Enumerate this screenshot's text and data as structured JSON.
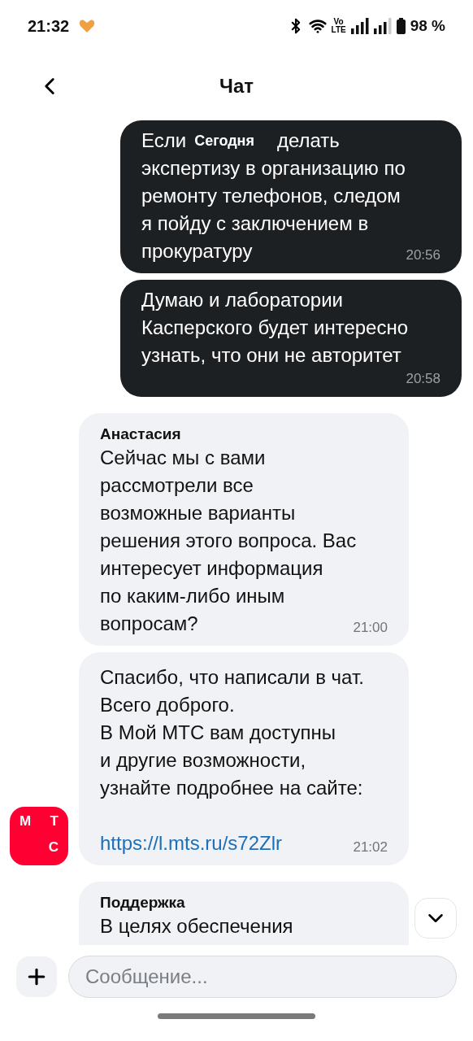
{
  "status_bar": {
    "time": "21:32",
    "volte_top": "Vo",
    "volte_bottom": "LTE",
    "battery": "98 %"
  },
  "header": {
    "title": "Чат"
  },
  "date_chip": "Сегодня",
  "messages": [
    {
      "kind": "outgoing",
      "lead": "Если",
      "lines": [
        "делать",
        "экспертизу в организацию по",
        "ремонту телефонов, следом",
        "я пойду с заключением в",
        "прокуратуру"
      ],
      "time": "20:56"
    },
    {
      "kind": "outgoing",
      "lines": [
        "Думаю и лаборатории",
        "Касперского будет интересно",
        "узнать, что они не авторитет"
      ],
      "time": "20:58"
    },
    {
      "kind": "incoming",
      "sender": "Анастасия",
      "lines": [
        "Сейчас мы с вами",
        "рассмотрели все",
        "возможные варианты",
        "решения этого вопроса. Вас",
        "интересует информация",
        "по каким-либо иным",
        "вопросам?"
      ],
      "time": "21:00"
    },
    {
      "kind": "incoming",
      "lines": [
        "Спасибо, что написали в чат.",
        "Всего доброго.",
        "В Мой МТС вам доступны",
        "и другие возможности,",
        "узнайте подробнее на сайте:"
      ],
      "link": "https://l.mts.ru/s72Zlr",
      "time": "21:02",
      "avatar": [
        "М",
        "Т",
        "С"
      ]
    },
    {
      "kind": "incoming",
      "sender": "Поддержка",
      "lines": [
        "В целях обеспечения"
      ]
    }
  ],
  "composer": {
    "placeholder": "Сообщение..."
  }
}
